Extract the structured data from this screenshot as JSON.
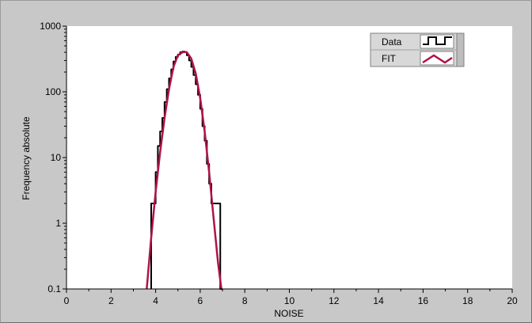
{
  "colors": {
    "background": "#c8c8c8",
    "plot_area": "#ffffff",
    "data_series": "#000000",
    "fit_series": "#b0124a"
  },
  "chart_data": {
    "type": "line",
    "title": "",
    "xlabel": "NOISE",
    "ylabel": "Frequency absolute",
    "xlim": [
      0,
      20
    ],
    "ylim": [
      0.1,
      1000
    ],
    "yscale": "log",
    "grid": false,
    "legend_position": "top-right",
    "x_ticks": [
      "0",
      "2",
      "4",
      "6",
      "8",
      "10",
      "12",
      "14",
      "16",
      "18",
      "20"
    ],
    "y_ticks": [
      "0.1",
      "1",
      "10",
      "100",
      "1000"
    ],
    "series": [
      {
        "name": "Data",
        "style": "step",
        "color": "#000000",
        "x": [
          3.8,
          3.9,
          4.0,
          4.1,
          4.2,
          4.3,
          4.4,
          4.5,
          4.6,
          4.7,
          4.8,
          4.9,
          5.0,
          5.1,
          5.2,
          5.3,
          5.4,
          5.5,
          5.6,
          5.7,
          5.8,
          5.9,
          6.0,
          6.1,
          6.2,
          6.3,
          6.4,
          6.5,
          6.6,
          6.7,
          6.8,
          6.9,
          7.0
        ],
        "y": [
          2,
          2,
          6,
          15,
          25,
          40,
          70,
          110,
          160,
          220,
          290,
          340,
          370,
          400,
          410,
          400,
          360,
          300,
          240,
          180,
          130,
          90,
          55,
          30,
          18,
          8,
          4,
          2,
          2,
          2,
          2,
          0.1,
          0.1
        ]
      },
      {
        "name": "FIT",
        "style": "line",
        "color": "#b0124a",
        "x": [
          3.6,
          3.8,
          4.0,
          4.2,
          4.4,
          4.6,
          4.8,
          5.0,
          5.2,
          5.3,
          5.4,
          5.6,
          5.8,
          6.0,
          6.2,
          6.4,
          6.6,
          6.8,
          6.95
        ],
        "y": [
          0.1,
          0.6,
          3,
          12,
          40,
          110,
          240,
          360,
          400,
          405,
          400,
          320,
          190,
          80,
          25,
          6,
          1.2,
          0.25,
          0.1
        ]
      }
    ],
    "legend": [
      {
        "label": "Data",
        "swatch": "step"
      },
      {
        "label": "FIT",
        "swatch": "zigzag"
      }
    ]
  }
}
